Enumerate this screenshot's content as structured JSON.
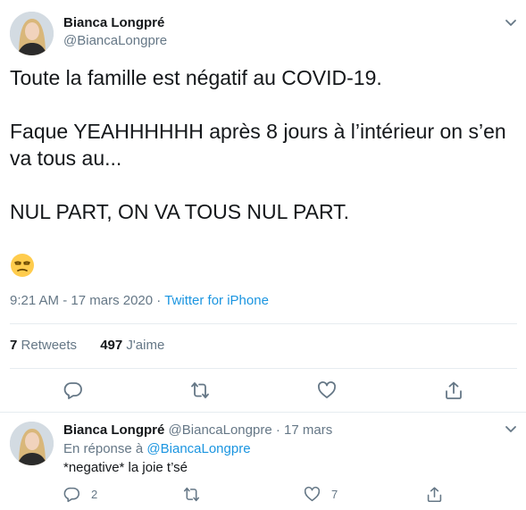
{
  "main_tweet": {
    "author_name": "Bianca Longpré",
    "author_handle": "@BiancaLongpre",
    "text": "Toute la famille est négatif au COVID-19.\n\nFaque YEAHHHHHH après 8 jours à l’intérieur on s’en va tous au...\n\nNUL PART, ON VA TOUS NUL PART.",
    "emoji": "unamused-face",
    "time": "9:21 AM",
    "date": "17 mars 2020",
    "separator": "·",
    "source": "Twitter for iPhone",
    "retweets_count": "7",
    "retweets_label": "Retweets",
    "likes_count": "497",
    "likes_label": "J'aime"
  },
  "reply_tweet": {
    "author_name": "Bianca Longpré",
    "author_handle": "@BiancaLongpre",
    "separator": "·",
    "date": "17 mars",
    "in_reply_prefix": "En réponse à",
    "in_reply_handle": "@BiancaLongpre",
    "text": "*negative* la joie t’sé",
    "reply_count": "2",
    "retweet_count": "",
    "like_count": "7"
  },
  "icons": {
    "caret": "chevron-down-icon",
    "reply": "reply-icon",
    "retweet": "retweet-icon",
    "like": "heart-icon",
    "share": "share-icon"
  },
  "colors": {
    "text": "#14171a",
    "secondary": "#657786",
    "link": "#1b95e0",
    "divider": "#e6ecf0"
  }
}
